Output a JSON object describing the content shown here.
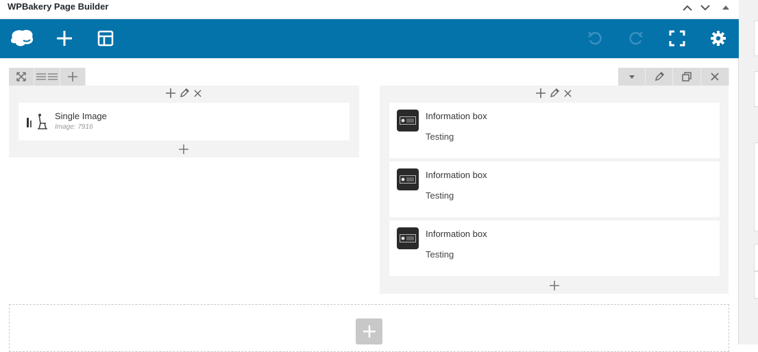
{
  "window": {
    "title": "WPBakery Page Builder"
  },
  "colors": {
    "toolbar": "#0473aa",
    "panel": "#f3f3f3",
    "command": "#dcdcdc"
  },
  "toolbar": {
    "icons": [
      "wpbakery-logo-icon",
      "add-element-icon",
      "templates-icon",
      "undo-icon",
      "redo-icon",
      "fullscreen-icon",
      "settings-icon"
    ]
  },
  "row": {
    "left_column": {
      "elements": [
        {
          "name": "Single Image",
          "subtitle": "Image: 7916"
        }
      ]
    },
    "right_column": {
      "elements": [
        {
          "name": "Information box",
          "text": "Testing"
        },
        {
          "name": "Information box",
          "text": "Testing"
        },
        {
          "name": "Information box",
          "text": "Testing"
        }
      ]
    }
  }
}
